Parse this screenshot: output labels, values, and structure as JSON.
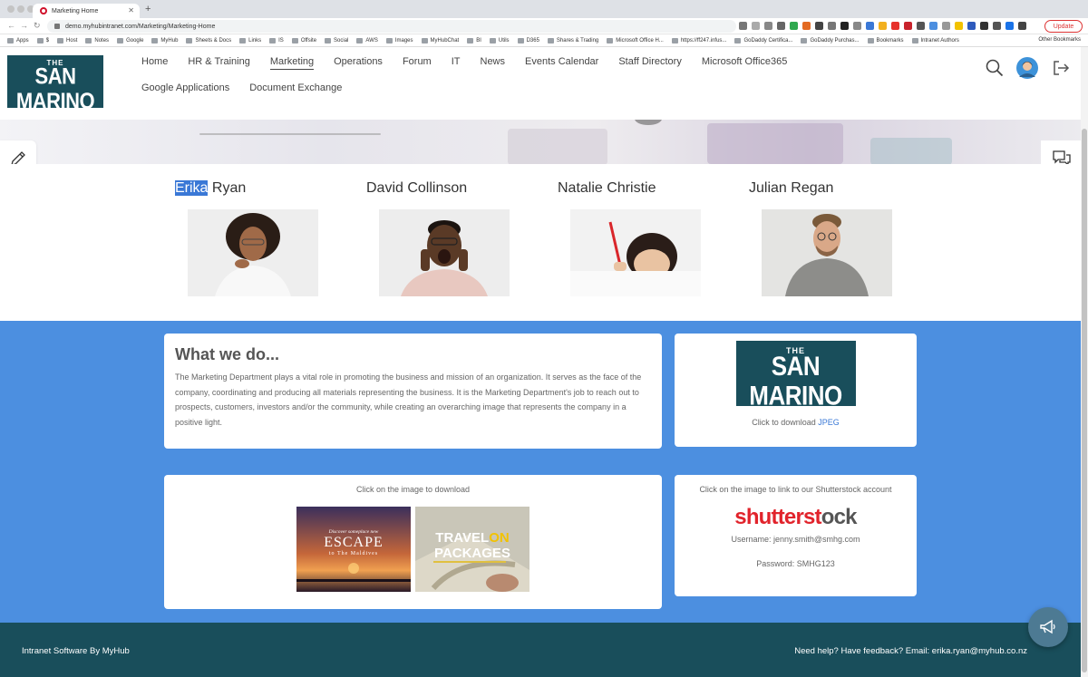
{
  "browser": {
    "tab_title": "Marketing Home",
    "url": "demo.myhubintranet.com/Marketing/Marketing-Home",
    "update_label": "Update",
    "bookmarks": [
      "Apps",
      "$",
      "Host",
      "Notes",
      "Google",
      "MyHub",
      "Sheets & Docs",
      "Links",
      "IS",
      "Offsite",
      "Social",
      "AWS",
      "Images",
      "MyHubChat",
      "BI",
      "Utils",
      "D365",
      "Shares & Trading",
      "Microsoft Office H...",
      "https://ff247.infus...",
      "GoDaddy Certifica...",
      "GoDaddy Purchas...",
      "Bookmarks",
      "Intranet Authors"
    ],
    "other_bookmarks": "Other Bookmarks"
  },
  "logo": {
    "the": "THE",
    "name": "SAN MARINO",
    "sub": "HOTEL GROUP"
  },
  "nav": {
    "items": [
      "Home",
      "HR & Training",
      "Marketing",
      "Operations",
      "Forum",
      "IT",
      "News",
      "Events Calendar",
      "Staff Directory",
      "Microsoft Office365",
      "Google Applications",
      "Document Exchange"
    ],
    "active": "Marketing"
  },
  "team": [
    {
      "first": "Erika",
      "last": " Ryan"
    },
    {
      "first": "David",
      "last": " Collinson"
    },
    {
      "first": "Natalie",
      "last": " Christie"
    },
    {
      "first": "Julian",
      "last": " Regan"
    }
  ],
  "what_we_do": {
    "title": "What we do...",
    "body": "The Marketing Department plays a vital role in promoting the business and mission of an organization. It serves as the face of the company, coordinating and producing all materials representing the business. It is the Marketing Department's job to reach out to prospects, customers, investors and/or the community, while creating an overarching image that represents the company in a positive light."
  },
  "logo_card": {
    "caption": "Click to download ",
    "link": "JPEG"
  },
  "images_card": {
    "caption": "Click on the image to download",
    "escape": {
      "kicker": "Discover someplace new",
      "title": "ESCAPE",
      "sub": "to The Maldives"
    },
    "travel": {
      "line1a": "TRAVEL",
      "line1b": "ON",
      "line2": "PACKAGES"
    }
  },
  "shutter_card": {
    "caption": "Click on the image to link to our Shutterstock account",
    "brand_a": "shutterst",
    "brand_b": "o",
    "brand_c": "ck",
    "username": "Username: jenny.smith@smhg.com",
    "password": "Password: SMHG123"
  },
  "footer": {
    "left": "Intranet Software By MyHub",
    "right": "Need help? Have feedback? Email: erika.ryan@myhub.co.nz"
  },
  "colors": {
    "brand": "#194e5b",
    "blue": "#4c8fe0",
    "link": "#3a78d6",
    "shutter_red": "#e1232b"
  }
}
